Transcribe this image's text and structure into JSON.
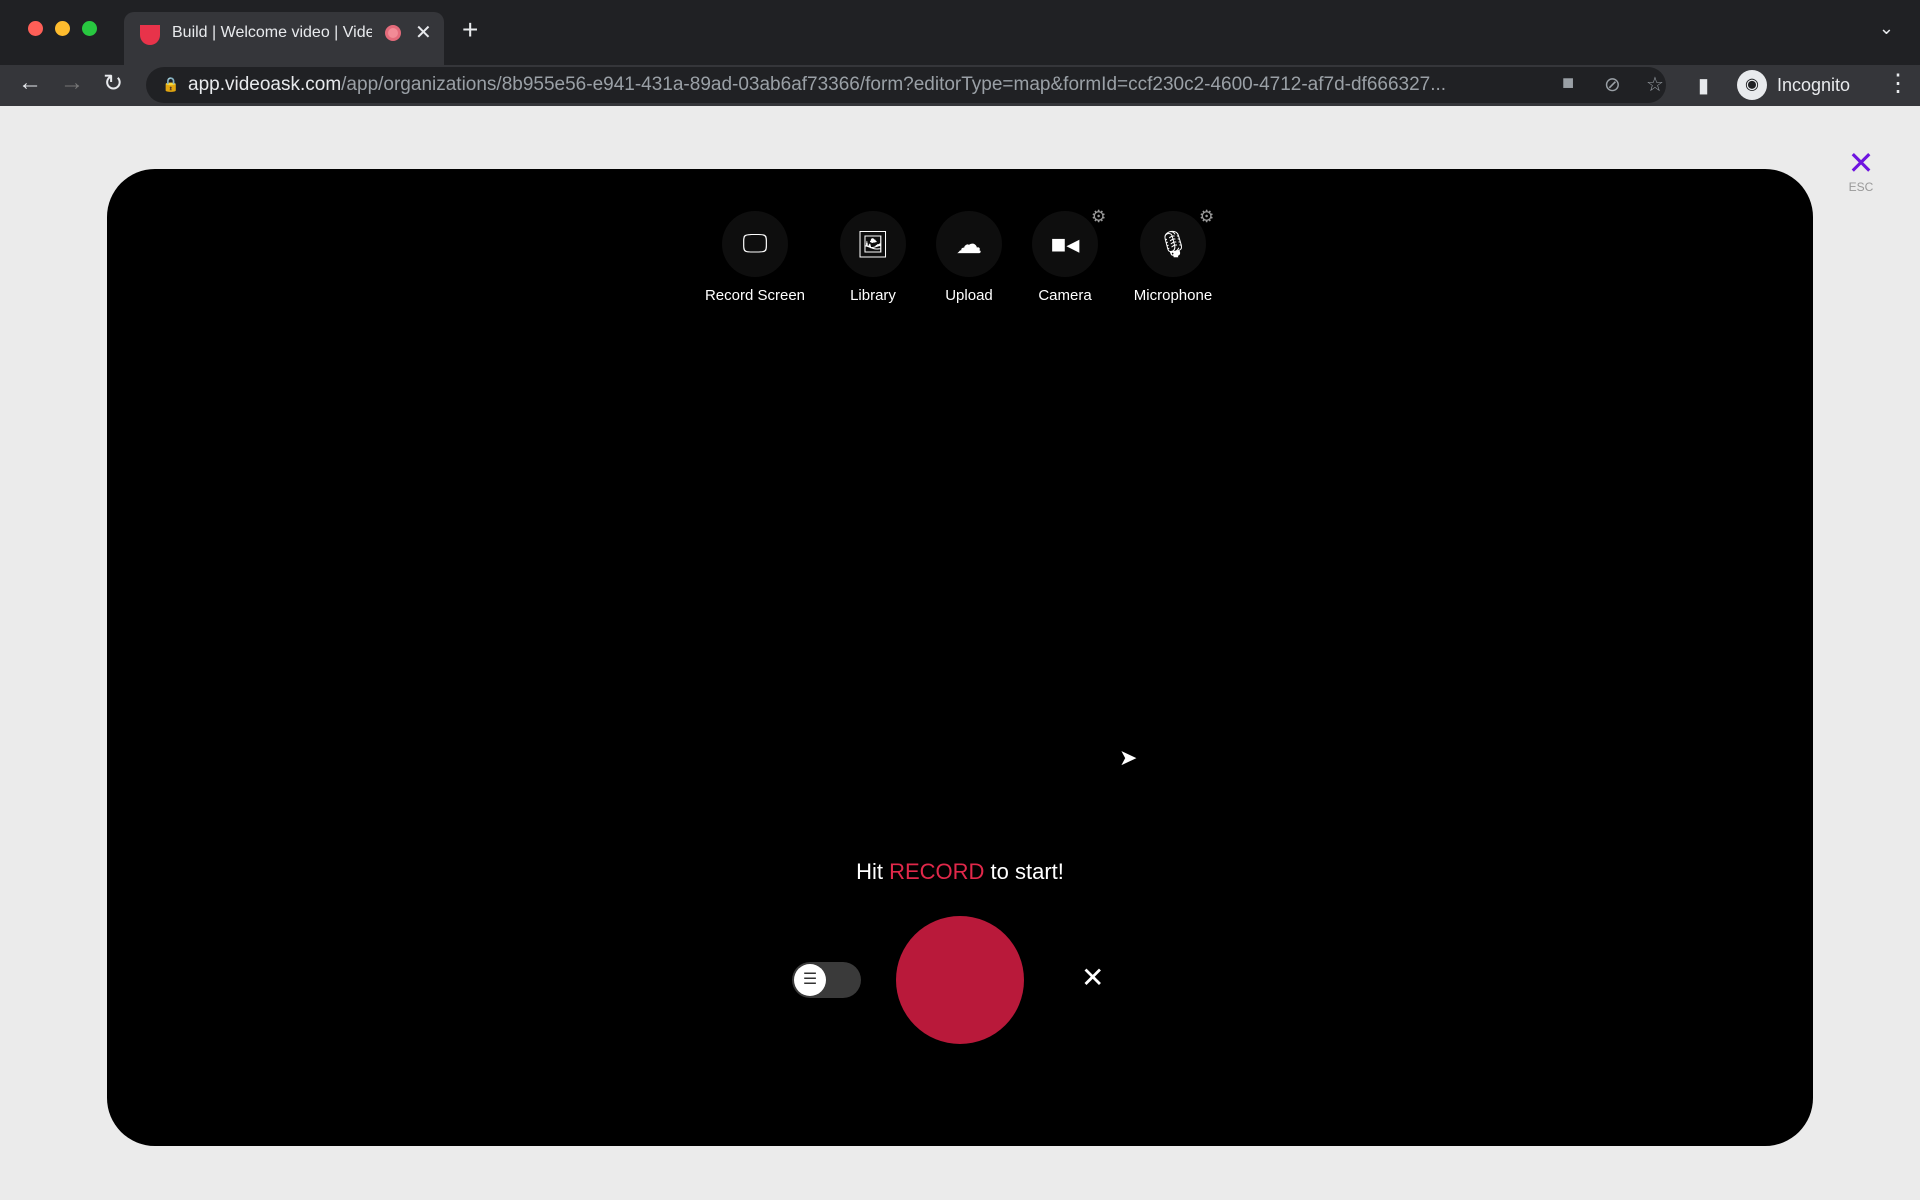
{
  "browser": {
    "tab_title": "Build | Welcome video | VideoAsk",
    "url_host": "app.videoask.com",
    "url_path": "/app/organizations/8b955e56-e941-431a-89ad-03ab6af73366/form?editorType=map&formId=ccf230c2-4600-4712-af7d-df666327...",
    "profile": "Incognito"
  },
  "recorder": {
    "sources": [
      {
        "label": "Record Screen",
        "icon": "monitor-icon"
      },
      {
        "label": "Library",
        "icon": "image-icon"
      },
      {
        "label": "Upload",
        "icon": "cloud-upload-icon"
      },
      {
        "label": "Camera",
        "icon": "video-camera-icon"
      },
      {
        "label": "Microphone",
        "icon": "microphone-icon"
      }
    ],
    "hint_pre": "Hit ",
    "hint_em": "RECORD",
    "hint_post": " to start!",
    "record_color": "#b9193a",
    "esc_label": "ESC"
  }
}
